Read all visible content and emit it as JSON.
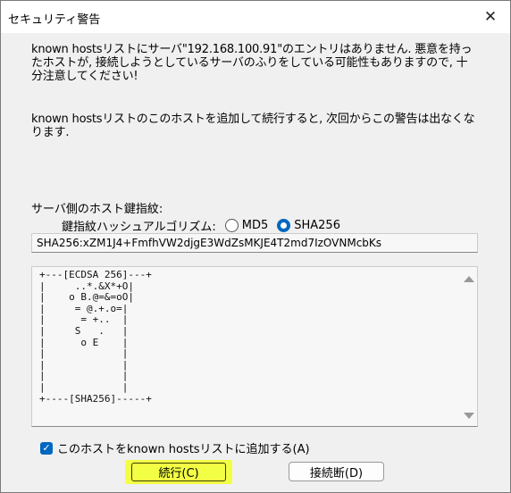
{
  "window": {
    "title": "セキュリティ警告",
    "close_glyph": "✕"
  },
  "warning": {
    "line1": "known hostsリストにサーバ\"192.168.100.91\"のエントリはありません. 悪意を持ったホストが, 接続しようとしているサーバのふりをしている可能性もありますので, 十分注意してください!",
    "line2": "known hostsリストのこのホストを追加して続行すると, 次回からこの警告は出なくなります."
  },
  "fingerprint": {
    "label": "サーバ側のホスト鍵指紋:",
    "algo_label": "鍵指紋ハッシュアルゴリズム:",
    "options": [
      {
        "label": "MD5",
        "selected": false
      },
      {
        "label": "SHA256",
        "selected": true
      }
    ],
    "value": "SHA256:xZM1J4+FmfhVW2djgE3WdZsMKJE4T2md7IzOVNMcbKs"
  },
  "randomart": "+---[ECDSA 256]---+\n|     ..*.&X*+O|\n|    o B.@=&=oO|\n|     = @.+.o=|\n|      = +..  |\n|     S   .   |\n|      o E    |\n|             |\n|             |\n|             |\n|             |\n+----[SHA256]-----+",
  "add_checkbox": {
    "label": "このホストをknown hostsリストに追加する(A)",
    "checked": true
  },
  "buttons": {
    "continue": "続行(C)",
    "disconnect": "接続断(D)"
  },
  "colors": {
    "accent": "#0067c0",
    "highlight": "#f3ff45"
  }
}
